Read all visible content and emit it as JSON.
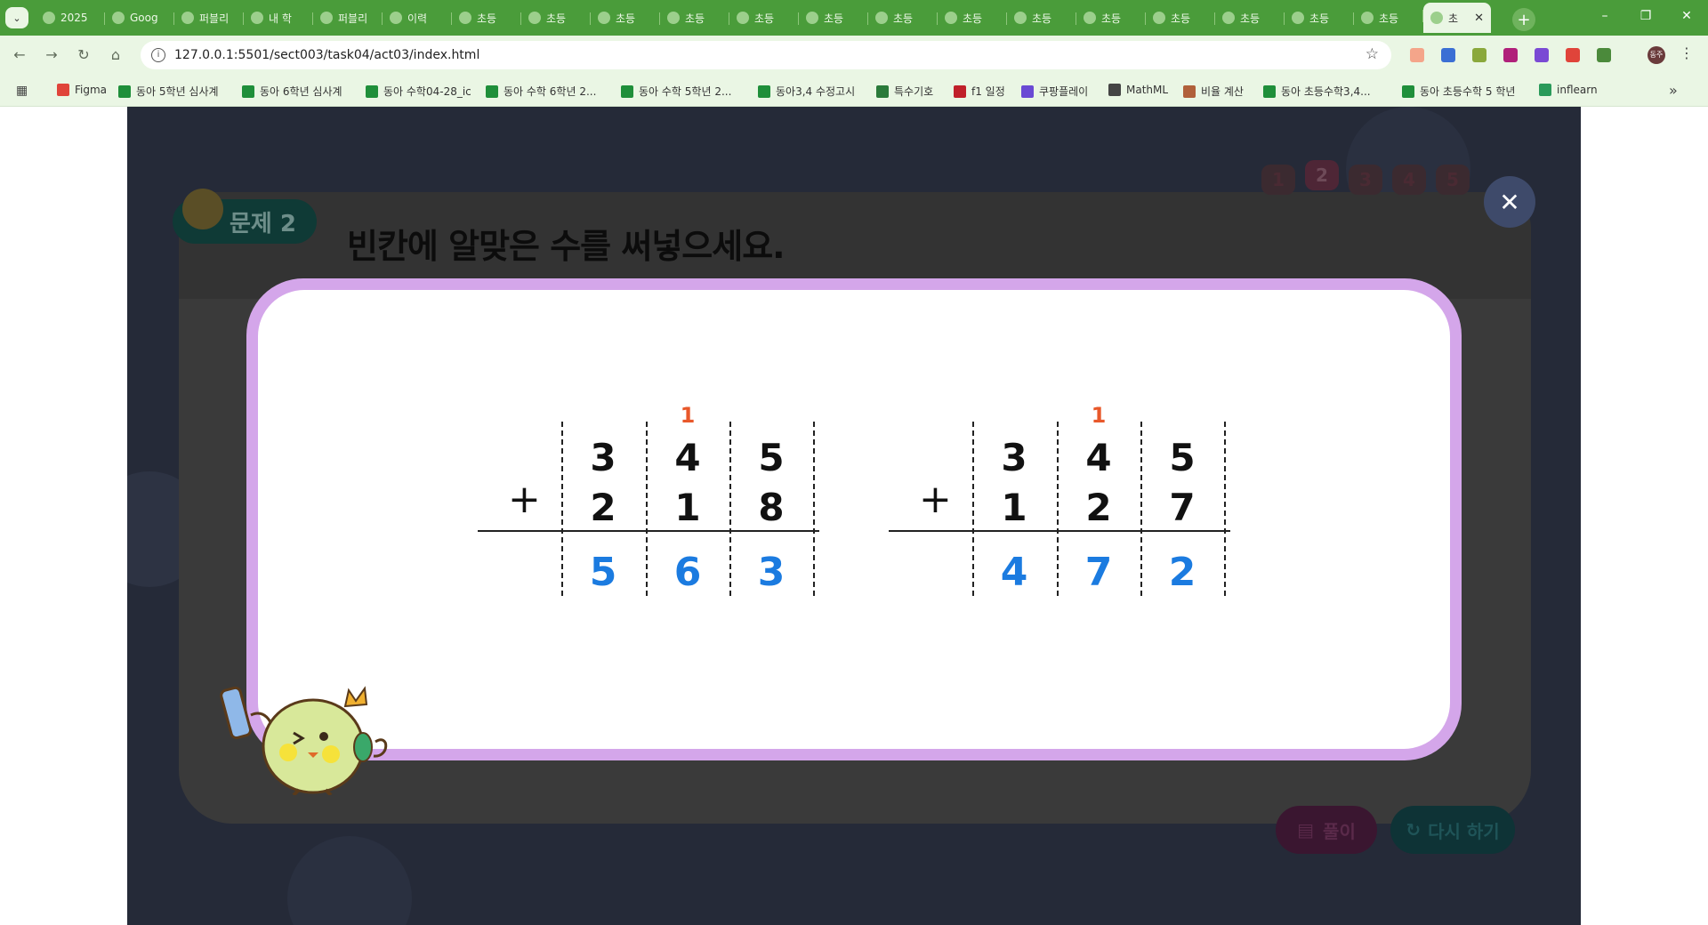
{
  "browser": {
    "tabs": [
      {
        "label": "2025",
        "active": false
      },
      {
        "label": "Goog",
        "active": false
      },
      {
        "label": "퍼블리",
        "active": false
      },
      {
        "label": "내 학",
        "active": false
      },
      {
        "label": "퍼블리",
        "active": false
      },
      {
        "label": "이력",
        "active": false
      },
      {
        "label": "초등",
        "active": false
      },
      {
        "label": "초등",
        "active": false
      },
      {
        "label": "초등",
        "active": false
      },
      {
        "label": "초등",
        "active": false
      },
      {
        "label": "초등",
        "active": false
      },
      {
        "label": "초등",
        "active": false
      },
      {
        "label": "초등",
        "active": false
      },
      {
        "label": "초등",
        "active": false
      },
      {
        "label": "초등",
        "active": false
      },
      {
        "label": "초등",
        "active": false
      },
      {
        "label": "초등",
        "active": false
      },
      {
        "label": "초등",
        "active": false
      },
      {
        "label": "초등",
        "active": false
      },
      {
        "label": "초등",
        "active": false
      },
      {
        "label": "초",
        "active": true
      }
    ],
    "new_tab_label": "+",
    "window_controls": {
      "minimize": "–",
      "restore": "❐",
      "close": "✕"
    },
    "url": "127.0.0.1:5501/sect003/task04/act03/index.html",
    "profile_initials": "동주",
    "bookmarks": [
      "Figma",
      "동아 5학년 심사계",
      "동아 6학년 심사계",
      "동아 수학04-28_ic",
      "동아 수학 6학년 2...",
      "동아 수학 5학년 2...",
      "동아3,4 수정고시",
      "특수기호",
      "f1 일정",
      "쿠팡플레이",
      "MathML",
      "비율 계산",
      "동아 초등수학3,4...",
      "동아 초등수학 5 학년",
      "inflearn"
    ]
  },
  "page": {
    "problem_badge": "문제 2",
    "question": "빈칸에 알맞은 수를 써넣으세요.",
    "pager": [
      "1",
      "2",
      "3",
      "4",
      "5"
    ],
    "current_page": 2,
    "solution_button": "풀이",
    "retry_button": "다시 하기",
    "close_symbol": "✕"
  },
  "modal": {
    "problems": [
      {
        "operator": "+",
        "carry": [
          "",
          "1",
          ""
        ],
        "top": [
          "3",
          "4",
          "5"
        ],
        "bottom": [
          "2",
          "1",
          "8"
        ],
        "answer": [
          "5",
          "6",
          "3"
        ]
      },
      {
        "operator": "+",
        "carry": [
          "",
          "1",
          ""
        ],
        "top": [
          "3",
          "4",
          "5"
        ],
        "bottom": [
          "1",
          "2",
          "7"
        ],
        "answer": [
          "4",
          "7",
          "2"
        ]
      }
    ]
  },
  "colors": {
    "modal_border": "#d4a6ea",
    "answer_digit": "#1b7be0",
    "carry_digit": "#e8582a",
    "browser_frame": "#4a9c3a"
  }
}
